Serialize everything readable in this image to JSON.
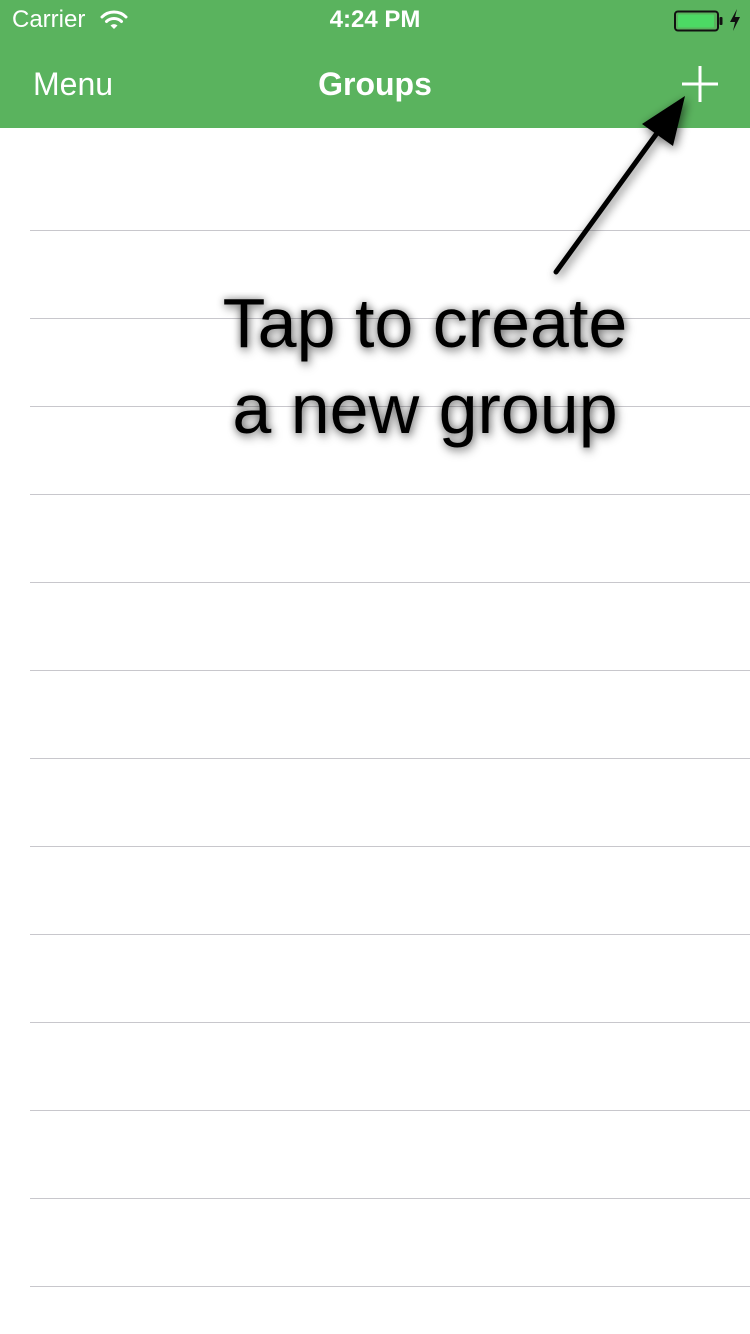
{
  "status_bar": {
    "carrier": "Carrier",
    "time": "4:24 PM",
    "wifi_icon": "wifi-icon",
    "battery_icon": "battery-icon",
    "charging_icon": "charging-bolt-icon"
  },
  "nav": {
    "left_button": "Menu",
    "title": "Groups",
    "add_icon": "plus-icon"
  },
  "tip": {
    "line1": "Tap to create",
    "line2": "a new group"
  },
  "groups": [],
  "colors": {
    "header": "#5ab35e",
    "header_text": "#ffffff",
    "separator": "#c8c7cc",
    "battery_fill": "#4cd964",
    "tip_text": "#000000"
  }
}
